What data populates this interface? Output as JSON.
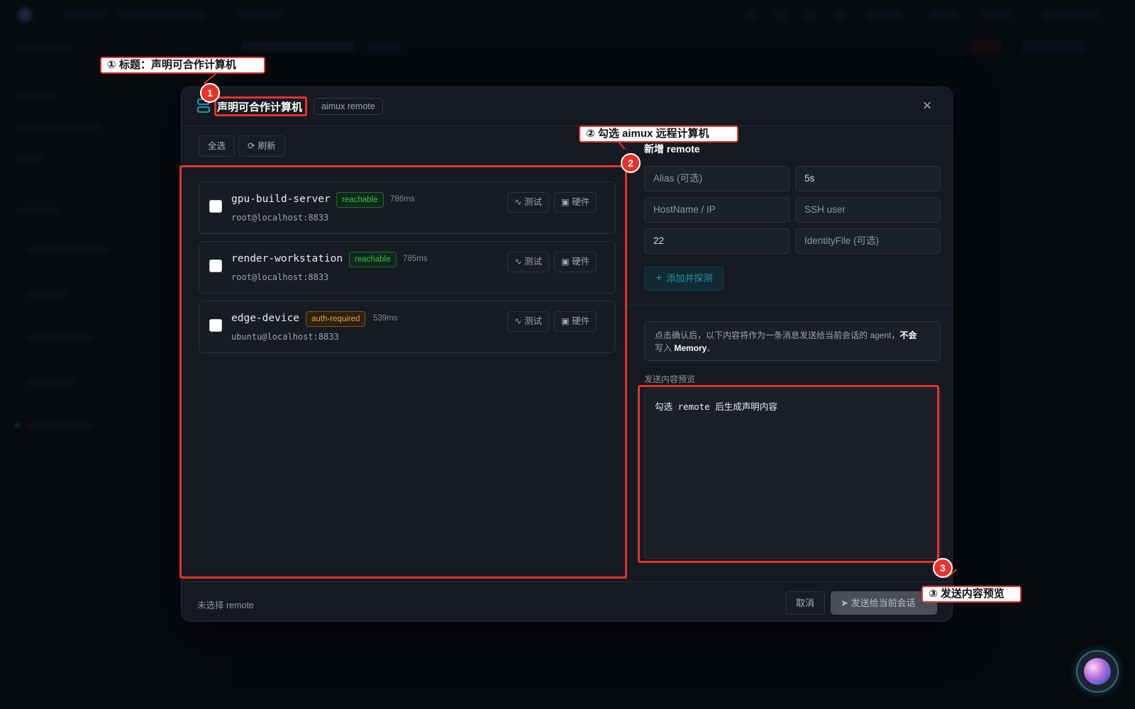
{
  "modal": {
    "title": "声明可合作计算机",
    "tag": "aimux remote",
    "close_icon": "×",
    "toolbar": {
      "select_all": "全选",
      "refresh": "刷新",
      "refresh_icon": "⟳"
    },
    "remotes": [
      {
        "name": "gpu-build-server",
        "status": "reachable",
        "latency": "786ms",
        "address": "root@localhost:8833"
      },
      {
        "name": "render-workstation",
        "status": "reachable",
        "latency": "785ms",
        "address": "root@localhost:8833"
      },
      {
        "name": "edge-device",
        "status": "auth-required",
        "latency": "539ms",
        "address": "ubuntu@localhost:8833"
      }
    ],
    "card_actions": {
      "test": "测试",
      "hardware": "硬件",
      "test_icon": "∿",
      "hardware_icon": "▣"
    },
    "add_remote": {
      "title": "新增 remote",
      "alias_placeholder": "Alias (可选)",
      "timeout_value": "5s",
      "hostname_placeholder": "HostName / IP",
      "ssh_user_placeholder": "SSH user",
      "port_value": "22",
      "identity_placeholder": "IdentityFile (可选)",
      "add_button": "添加并探测",
      "add_icon": "+"
    },
    "notice": {
      "text": "点击确认后，以下内容将作为一条消息发送给当前会话的 agent，",
      "bold1": "不会",
      "text2": "写入 ",
      "bold2": "Memory",
      "text3": "。"
    },
    "preview": {
      "label": "发送内容预览",
      "content": "勾选 remote 后生成声明内容"
    },
    "footer": {
      "status": "未选择 remote",
      "cancel": "取消",
      "send": "发送给当前会话",
      "send_icon": "➤"
    }
  },
  "annotations": [
    {
      "number": "1",
      "label": "① 标题：声明可合作计算机"
    },
    {
      "number": "2",
      "label": "② 勾选 aimux 远程计算机"
    },
    {
      "number": "3",
      "label": "③ 发送内容预览"
    }
  ],
  "colors": {
    "accent_red": "#e5332a",
    "reachable": "#3fb950",
    "auth_required": "#e3a33b",
    "teal": "#2a8fa6"
  }
}
